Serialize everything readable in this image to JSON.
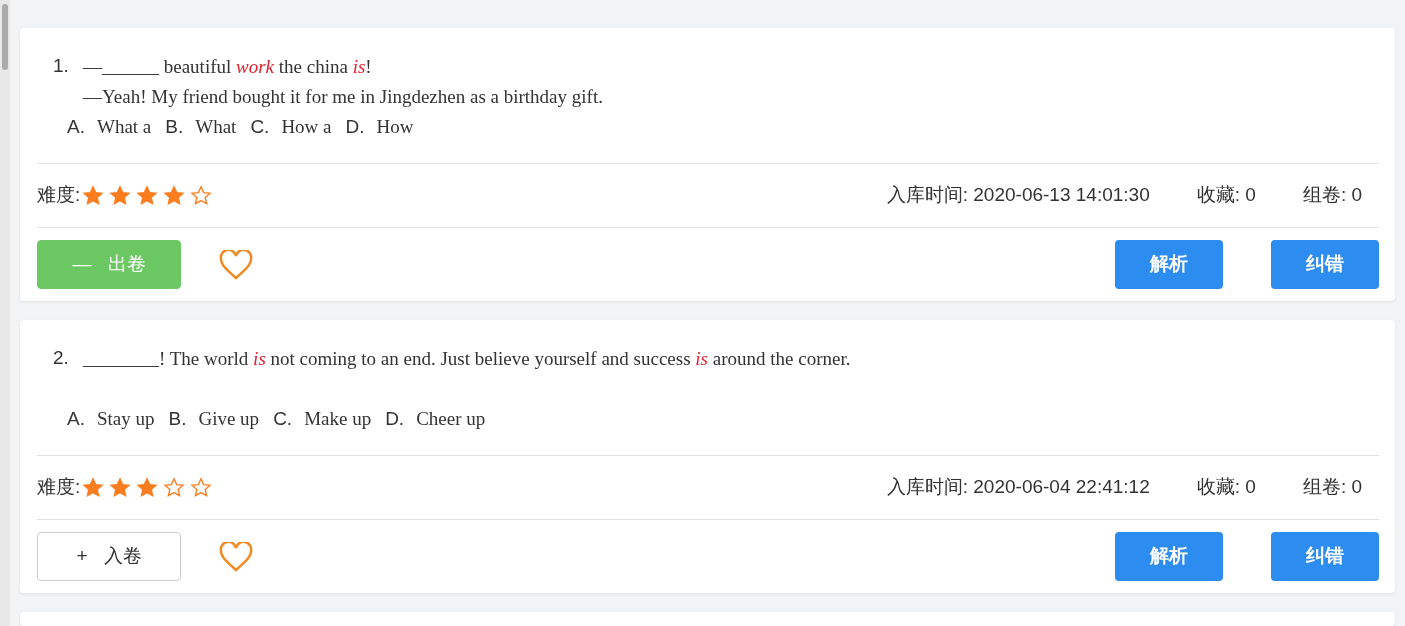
{
  "questions": [
    {
      "number": "1.",
      "stem": [
        "—______ beautiful *work* the china *is*!",
        "—Yeah! My friend bought it for me in Jingdezhen as a birthday gift."
      ],
      "options": [
        {
          "letter": "A.",
          "text": "What a"
        },
        {
          "letter": "B.",
          "text": "What"
        },
        {
          "letter": "C.",
          "text": "How a"
        },
        {
          "letter": "D.",
          "text": "How"
        }
      ],
      "difficulty_label": "难度:",
      "stars": 4,
      "added_time": "入库时间: 2020-06-13 14:01:30",
      "favorites": "收藏: 0",
      "used": "组卷: 0",
      "paper_button": {
        "in_paper": true,
        "symbol": "—",
        "label": "出卷"
      },
      "favorited": false,
      "analysis_button": "解析",
      "report_button": "纠错"
    },
    {
      "number": "2.",
      "stem": [
        "________! The world *is* not coming to an end. Just believe yourself and success *is* around the corner."
      ],
      "options": [
        {
          "letter": "A.",
          "text": "Stay up"
        },
        {
          "letter": "B.",
          "text": "Give up"
        },
        {
          "letter": "C.",
          "text": "Make up"
        },
        {
          "letter": "D.",
          "text": "Cheer up"
        }
      ],
      "difficulty_label": "难度:",
      "stars": 3,
      "added_time": "入库时间: 2020-06-04 22:41:12",
      "favorites": "收藏: 0",
      "used": "组卷: 0",
      "paper_button": {
        "in_paper": false,
        "symbol": "+",
        "label": "入卷"
      },
      "favorited": false,
      "analysis_button": "解析",
      "report_button": "纠错"
    }
  ]
}
